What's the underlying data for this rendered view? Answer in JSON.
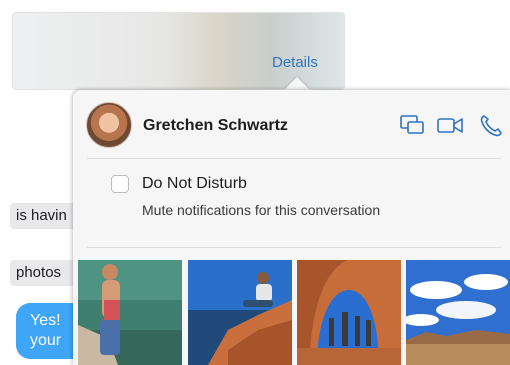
{
  "chat": {
    "details_label": "Details",
    "bubbles_gray": [
      "is havin",
      "photos"
    ],
    "bubble_blue_lines": [
      "Yes!  ",
      "your"
    ]
  },
  "popover": {
    "contact_name": "Gretchen Schwartz",
    "dnd": {
      "label": "Do Not Disturb",
      "description": "Mute notifications for this conversation",
      "checked": false
    },
    "actions": [
      "screen-share-icon",
      "video-call-icon",
      "phone-call-icon"
    ],
    "photos": [
      "photo-cliff-swimmer",
      "photo-rock-sitter",
      "photo-arch-group",
      "photo-desert-sky"
    ]
  },
  "colors": {
    "accent": "#2f74c0",
    "bubble_blue": "#3ea5f7",
    "popover_bg": "#f6f6f6"
  }
}
